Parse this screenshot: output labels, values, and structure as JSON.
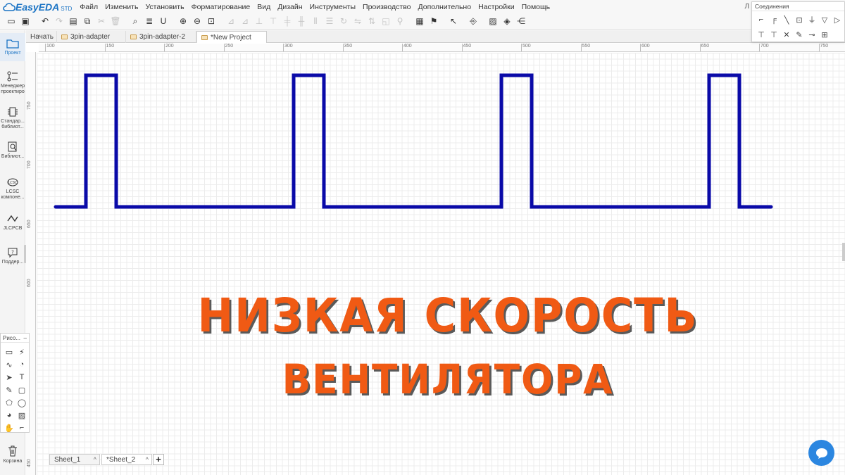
{
  "app": {
    "logo": "EasyEDA",
    "edition": "STD",
    "user_initial": "Л"
  },
  "menu": [
    "Файл",
    "Изменить",
    "Установить",
    "Форматирование",
    "Вид",
    "Дизайн",
    "Инструменты",
    "Производство",
    "Дополнительно",
    "Настройки",
    "Помощь"
  ],
  "tabs": [
    {
      "label": "Начать"
    },
    {
      "label": "3pin-adapter"
    },
    {
      "label": "3pin-adapter-2"
    },
    {
      "label": "*New Project"
    }
  ],
  "sidebar": {
    "items": [
      {
        "label": "Проект"
      },
      {
        "label": "Менеджер проектиро"
      },
      {
        "label": "Стандар... библиот..."
      },
      {
        "label": "Библиот..."
      },
      {
        "label": "LCSC компоне..."
      },
      {
        "label": "JLCPCB"
      },
      {
        "label": "Поддер..."
      }
    ],
    "trash": "Корзина"
  },
  "connections_panel": {
    "title": "Соединения"
  },
  "drawing_panel": {
    "title": "Рисо..."
  },
  "ruler_h": [
    "100",
    "150",
    "200",
    "250",
    "300",
    "350",
    "400",
    "450",
    "500",
    "550",
    "600",
    "650",
    "700",
    "750"
  ],
  "ruler_v": [
    "750",
    "700",
    "650",
    "600",
    "450"
  ],
  "canvas": {
    "title_line1": "НИЗКАЯ СКОРОСТЬ",
    "title_line2": "ВЕНТИЛЯТОРА",
    "wave_color": "#0a0aa8",
    "title_color": "#f05a14"
  },
  "sheets": [
    {
      "label": "Sheet_1"
    },
    {
      "label": "*Sheet_2"
    }
  ],
  "sheet_add_label": "+"
}
